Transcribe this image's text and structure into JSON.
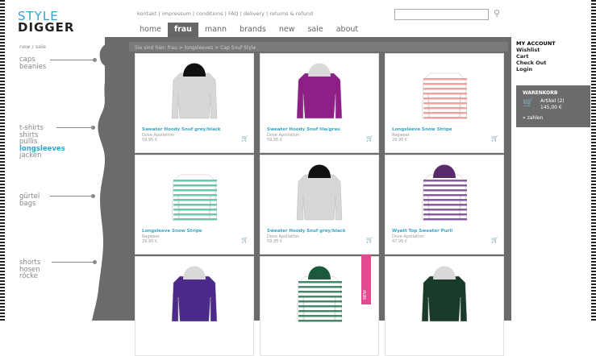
{
  "brand": {
    "line1": "STYLE",
    "line2": "DIGGER"
  },
  "topnav": {
    "links": [
      "kontakt",
      "impressum",
      "conditions",
      "FAQ",
      "delivery",
      "returns & refund"
    ]
  },
  "mainnav": {
    "items": [
      "home",
      "frau",
      "mann",
      "brands",
      "new",
      "sale",
      "about"
    ],
    "active": "frau"
  },
  "breadcrumb": "Sie sind hier: frau > longsleeves > Cap Snuf Style",
  "sidebar": {
    "top": "new / sale",
    "group1": [
      "caps",
      "beanies"
    ],
    "group2": [
      "t-shirts",
      "shirts",
      "pullis",
      "longsleeves",
      "jacken"
    ],
    "group2_active": "longsleeves",
    "group3": [
      "gürtel",
      "bags"
    ],
    "group4": [
      "shorts",
      "hosen",
      "röcke"
    ]
  },
  "account": {
    "title": "MY ACCOUNT",
    "links": [
      "Wishlist",
      "Cart",
      "Check Out",
      "Login"
    ]
  },
  "cart": {
    "title": "WARENKORB",
    "items": "Artikel (2)",
    "total": "145,00 €",
    "pay": "» zahlen"
  },
  "products": [
    {
      "name": "Sweater Hoody Snuf grey/black",
      "brand": "Dove Apollatton",
      "price": "59,95 €",
      "color": "#d7d7d7",
      "hood": "#111111",
      "stripes": ""
    },
    {
      "name": "Sweater Hoody Snuf lila/grau",
      "brand": "Dove Apollatton",
      "price": "59,95 €",
      "color": "#8e1f86",
      "hood": "#d9d9d9",
      "stripes": ""
    },
    {
      "name": "Longsleeve Snow Stripe",
      "brand": "Ragwear",
      "price": "29,95 €",
      "color": "#ffffff",
      "hood": "",
      "stripes": "#e89a9a"
    },
    {
      "name": "Longsleeve Snow Stripe",
      "brand": "Ragwear",
      "price": "29,95 €",
      "color": "#ffffff",
      "hood": "",
      "stripes": "#5fbfa3"
    },
    {
      "name": "Sweater Hoody Snuf grey/black",
      "brand": "Dove Apollatton",
      "price": "59,95 €",
      "color": "#d7d7d7",
      "hood": "#111111",
      "stripes": ""
    },
    {
      "name": "Wyatt Top Sweater Purli",
      "brand": "Dove Apollatton",
      "price": "47,95 €",
      "color": "#ffffff",
      "hood": "#5a2a6a",
      "stripes": "#7a4a9a"
    },
    {
      "name": "",
      "brand": "",
      "price": "",
      "color": "#4b2a8a",
      "hood": "#d9d9d9",
      "stripes": ""
    },
    {
      "name": "",
      "brand": "",
      "price": "",
      "color": "#ffffff",
      "hood": "#1b5b3b",
      "stripes": "#2e7d5a"
    },
    {
      "name": "",
      "brand": "",
      "price": "",
      "color": "#1a3a2a",
      "hood": "#d9d9d9",
      "stripes": ""
    }
  ],
  "new_tag": "NEW"
}
